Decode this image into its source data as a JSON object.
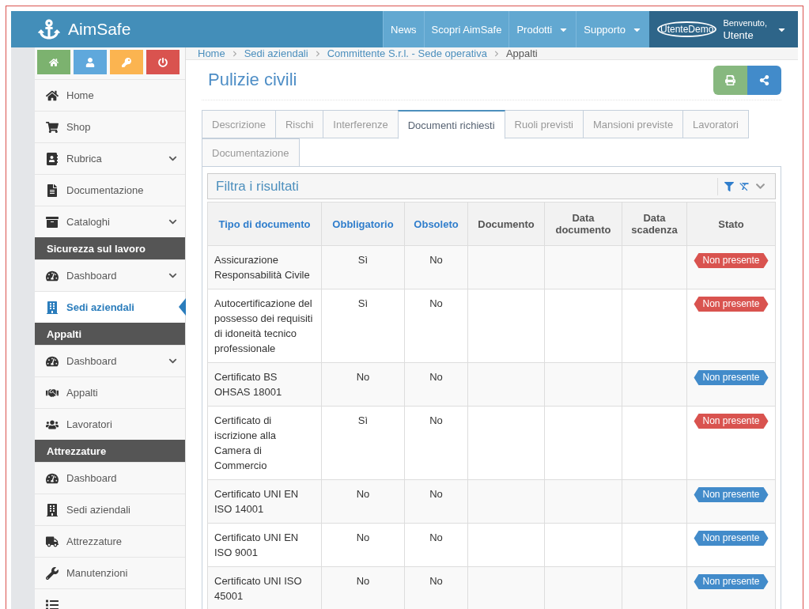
{
  "brand": "AimSafe",
  "nav": [
    {
      "label": "News",
      "dropdown": false
    },
    {
      "label": "Scopri AimSafe",
      "dropdown": false
    },
    {
      "label": "Prodotti",
      "dropdown": true
    },
    {
      "label": "Supporto",
      "dropdown": true
    }
  ],
  "user": {
    "avatar": "UtenteDemo",
    "greeting": "Benvenuto,",
    "name": "Utente"
  },
  "quick_buttons": [
    {
      "color": "#7cb26f"
    },
    {
      "color": "#5fa8dc"
    },
    {
      "color": "#fbb450"
    },
    {
      "color": "#d9534f"
    }
  ],
  "sidebar": [
    {
      "kind": "item",
      "label": "Home",
      "expandable": false,
      "selected": false
    },
    {
      "kind": "item",
      "label": "Shop",
      "expandable": false,
      "selected": false
    },
    {
      "kind": "item",
      "label": "Rubrica",
      "expandable": true,
      "selected": false
    },
    {
      "kind": "item",
      "label": "Documentazione",
      "expandable": false,
      "selected": false
    },
    {
      "kind": "item",
      "label": "Cataloghi",
      "expandable": true,
      "selected": false
    },
    {
      "kind": "header",
      "label": "Sicurezza sul lavoro"
    },
    {
      "kind": "item",
      "label": "Dashboard",
      "expandable": true,
      "selected": false
    },
    {
      "kind": "item",
      "label": "Sedi aziendali",
      "expandable": false,
      "selected": true
    },
    {
      "kind": "header",
      "label": "Appalti"
    },
    {
      "kind": "item",
      "label": "Dashboard",
      "expandable": true,
      "selected": false
    },
    {
      "kind": "item",
      "label": "Appalti",
      "expandable": false,
      "selected": false
    },
    {
      "kind": "item",
      "label": "Lavoratori",
      "expandable": false,
      "selected": false
    },
    {
      "kind": "header",
      "label": "Attrezzature"
    },
    {
      "kind": "item",
      "label": "Dashboard",
      "expandable": false,
      "selected": false
    },
    {
      "kind": "item",
      "label": "Sedi aziendali",
      "expandable": false,
      "selected": false
    },
    {
      "kind": "item",
      "label": "Attrezzature",
      "expandable": false,
      "selected": false
    },
    {
      "kind": "item",
      "label": "Manutenzioni",
      "expandable": false,
      "selected": false
    },
    {
      "kind": "item",
      "selected": false
    }
  ],
  "breadcrumb": [
    "Home",
    "Sedi aziendali",
    "Committente S.r.l. - Sede operativa",
    "Appalti"
  ],
  "page_title": "Pulizie civili",
  "tabs": [
    {
      "label": "Descrizione",
      "selected": false
    },
    {
      "label": "Rischi",
      "selected": false
    },
    {
      "label": "Interferenze",
      "selected": false
    },
    {
      "label": "Documenti richiesti",
      "selected": true
    },
    {
      "label": "Ruoli previsti",
      "selected": false
    },
    {
      "label": "Mansioni previste",
      "selected": false
    },
    {
      "label": "Lavoratori",
      "selected": false
    },
    {
      "label": "Documentazione",
      "selected": false
    }
  ],
  "filter": {
    "title": "Filtra i risultati"
  },
  "table": {
    "columns": [
      {
        "label": "Tipo di documento",
        "sortable": true
      },
      {
        "label": "Obbligatorio",
        "sortable": true
      },
      {
        "label": "Obsoleto",
        "sortable": true
      },
      {
        "label": "Documento",
        "sortable": false
      },
      {
        "label": "Data documento",
        "sortable": false
      },
      {
        "label": "Data scadenza",
        "sortable": false
      },
      {
        "label": "Stato",
        "sortable": false
      }
    ],
    "rows": [
      {
        "tipo": "Assicurazione Responsabilità Civile",
        "obbligatorio": "Sì",
        "obsoleto": "No",
        "stato": "Non presente",
        "color": "#d9534f"
      },
      {
        "tipo": "Autocertificazione del possesso dei requisiti di idoneità tecnico professionale",
        "obbligatorio": "Sì",
        "obsoleto": "No",
        "stato": "Non presente",
        "color": "#d9534f"
      },
      {
        "tipo": "Certificato BS OHSAS 18001",
        "obbligatorio": "No",
        "obsoleto": "No",
        "stato": "Non presente",
        "color": "#428bca"
      },
      {
        "tipo": "Certificato di iscrizione alla Camera di Commercio",
        "obbligatorio": "Sì",
        "obsoleto": "No",
        "stato": "Non presente",
        "color": "#d9534f"
      },
      {
        "tipo": "Certificato UNI EN ISO 14001",
        "obbligatorio": "No",
        "obsoleto": "No",
        "stato": "Non presente",
        "color": "#428bca"
      },
      {
        "tipo": "Certificato UNI EN ISO 9001",
        "obbligatorio": "No",
        "obsoleto": "No",
        "stato": "Non presente",
        "color": "#428bca"
      },
      {
        "tipo": "Certificato UNI ISO 45001",
        "obbligatorio": "No",
        "obsoleto": "No",
        "stato": "Non presente",
        "color": "#428bca"
      }
    ]
  }
}
